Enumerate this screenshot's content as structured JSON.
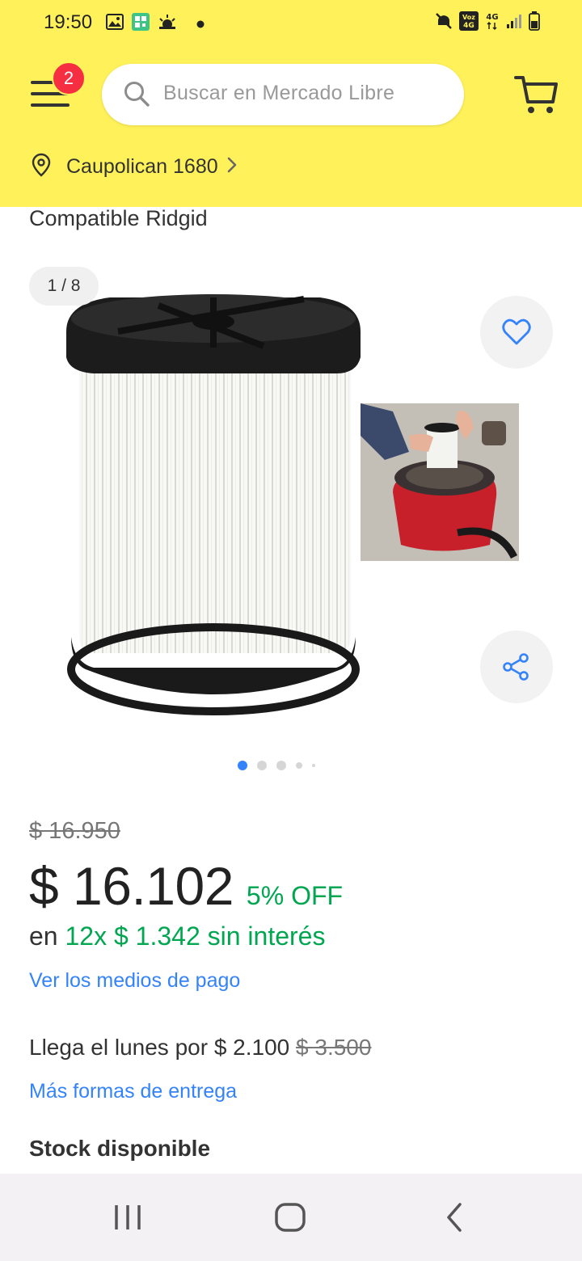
{
  "status_bar": {
    "time": "19:50",
    "left_icons": [
      "image-icon",
      "qr-icon",
      "weather-icon",
      "dot-icon"
    ],
    "right_icons": [
      "mute-icon",
      "volte-icon",
      "network-4g-icon",
      "signal-icon",
      "battery-icon"
    ],
    "volte_label": "Voz 4G",
    "network_label": "4G"
  },
  "header": {
    "notification_count": "2",
    "search_placeholder": "Buscar en Mercado Libre",
    "location": "Caupolican 1680",
    "accent_color": "#fff159"
  },
  "product": {
    "title_fragment": "Compatible Ridgid",
    "image_counter": "1 / 8",
    "gallery": {
      "total_dots": 5,
      "active_index": 0
    },
    "old_price": "$ 16.950",
    "price": "$ 16.102",
    "discount": "5% OFF",
    "installments_prefix": "en",
    "installments_highlight": "12x $ 1.342 sin interés",
    "payment_link": "Ver los medios de pago",
    "delivery_text": "Llega el lunes por $ 2.100",
    "delivery_old_price": "$ 3.500",
    "delivery_link": "Más formas de entrega",
    "stock": "Stock disponible"
  },
  "colors": {
    "price_green": "#00a650",
    "link_blue": "#3483fa",
    "badge_red": "#f52f41"
  }
}
